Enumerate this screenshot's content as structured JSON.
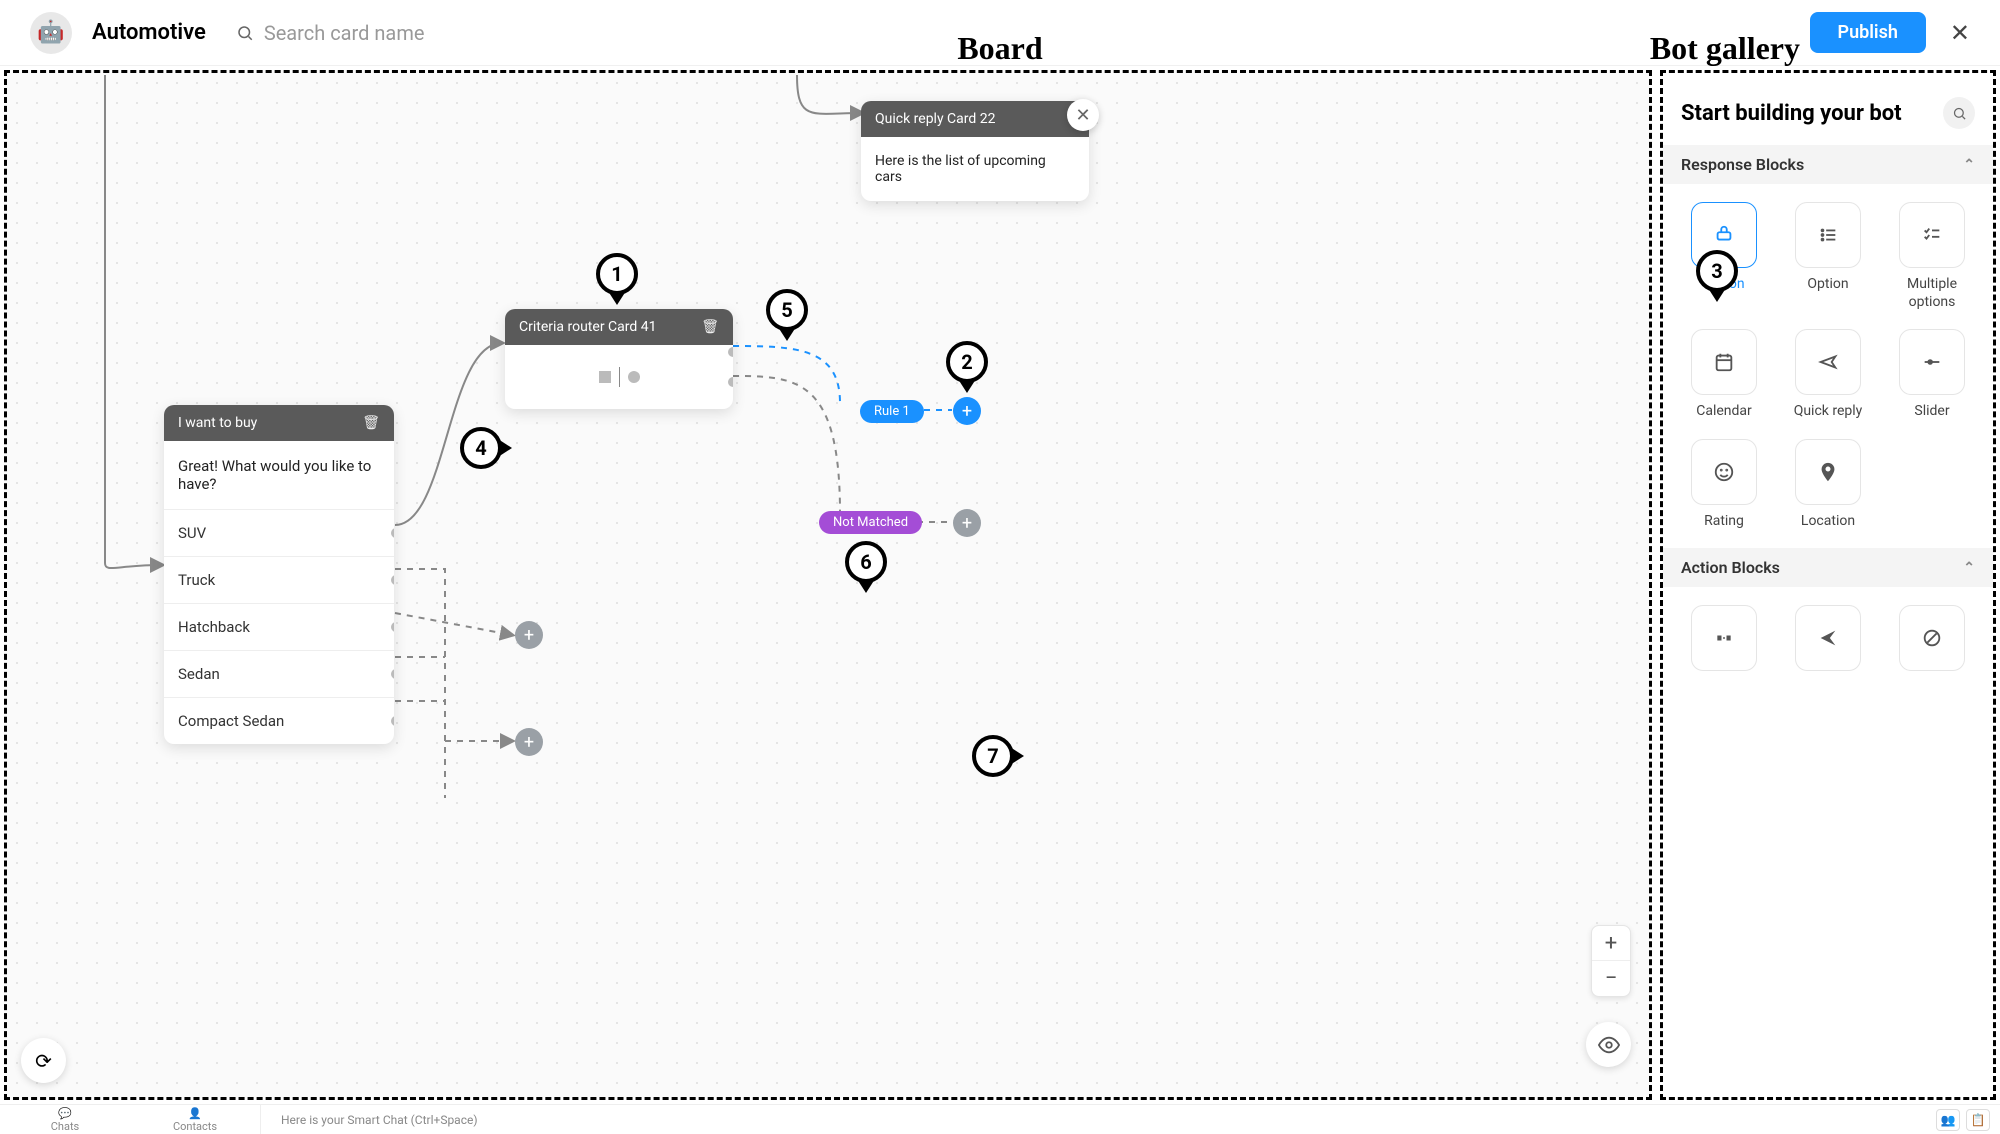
{
  "header": {
    "project": "Automotive",
    "search_placeholder": "Search card name",
    "publish": "Publish",
    "board_label": "Board",
    "gallery_label": "Bot gallery"
  },
  "board": {
    "quick_reply_card": {
      "title": "Quick reply Card 22",
      "body": "Here is the list of upcoming cars"
    },
    "options_card": {
      "title": "I want to buy",
      "prompt": "Great! What would you like to have?",
      "options": [
        "SUV",
        "Truck",
        "Hatchback",
        "Sedan",
        "Compact Sedan"
      ]
    },
    "criteria_card": {
      "title": "Criteria router Card 41"
    },
    "rule_badge": "Rule 1",
    "not_matched": "Not Matched"
  },
  "gallery": {
    "title": "Start building your bot",
    "section_response": "Response Blocks",
    "section_action": "Action Blocks",
    "response_blocks": [
      {
        "name": "Button",
        "active": true
      },
      {
        "name": "Option"
      },
      {
        "name": "Multiple options"
      },
      {
        "name": "Calendar"
      },
      {
        "name": "Quick reply"
      },
      {
        "name": "Slider"
      },
      {
        "name": "Rating"
      },
      {
        "name": "Location"
      }
    ]
  },
  "footer": {
    "nav": [
      "Chats",
      "Contacts"
    ],
    "hint": "Here is your Smart Chat (Ctrl+Space)"
  },
  "annotations": [
    "1",
    "2",
    "3",
    "4",
    "5",
    "6",
    "7"
  ]
}
